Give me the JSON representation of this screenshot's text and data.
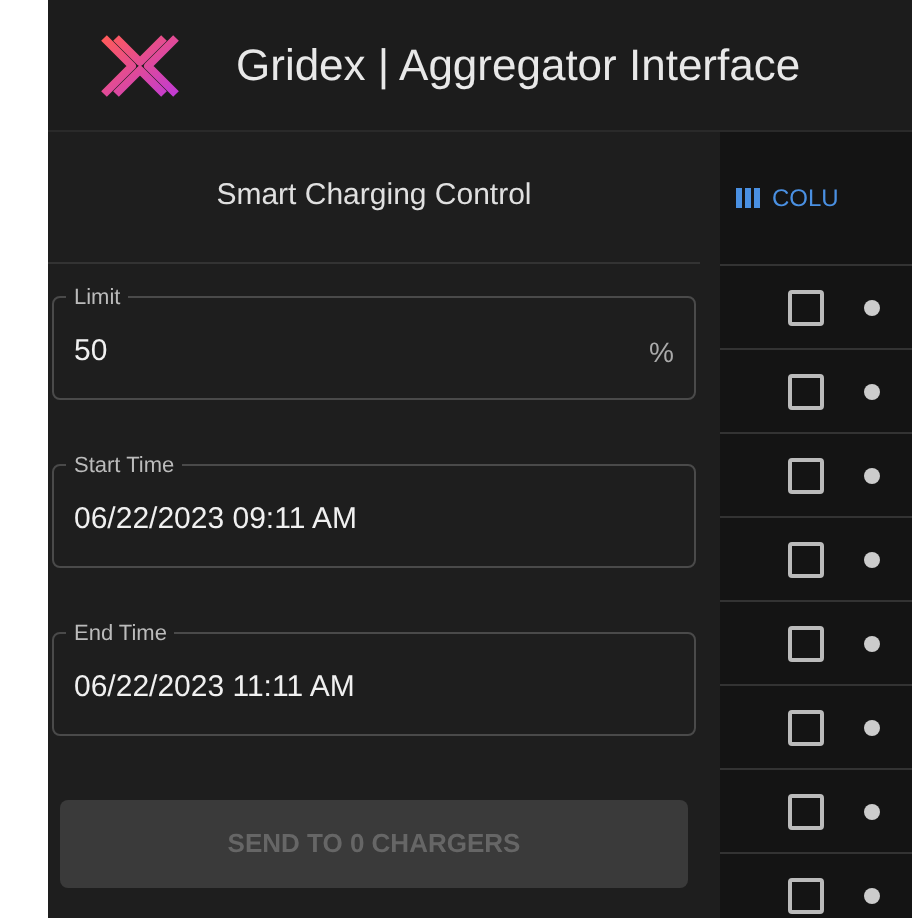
{
  "header": {
    "title": "Gridex | Aggregator Interface"
  },
  "panel": {
    "title": "Smart Charging Control",
    "fields": [
      {
        "label": "Limit",
        "value": "50",
        "unit": "%"
      },
      {
        "label": "Start Time",
        "value": "06/22/2023 09:11 AM"
      },
      {
        "label": "End Time",
        "value": "06/22/2023 11:11 AM"
      }
    ],
    "button": {
      "label": "SEND TO 0 CHARGERS",
      "disabled": true
    }
  },
  "table": {
    "toolbar_button": "COLU",
    "rows": [
      {
        "checked": false
      },
      {
        "checked": false
      },
      {
        "checked": false
      },
      {
        "checked": false
      },
      {
        "checked": false
      },
      {
        "checked": false
      },
      {
        "checked": false
      },
      {
        "checked": false
      }
    ]
  }
}
